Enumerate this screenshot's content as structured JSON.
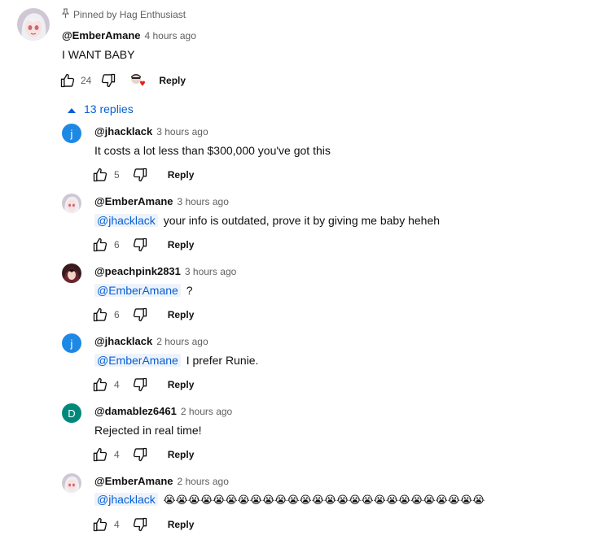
{
  "top_comment": {
    "pinned_label": "Pinned by Hag Enthusiast",
    "author": "@EmberAmane",
    "time": "4 hours ago",
    "text": "I WANT BABY",
    "likes": "24",
    "reply_label": "Reply"
  },
  "replies_toggle": {
    "label": "13 replies"
  },
  "replies": [
    {
      "author": "@jhacklack",
      "time": "3 hours ago",
      "mention": "",
      "text": "It costs a lot less than $300,000 you've got this",
      "likes": "5",
      "reply_label": "Reply",
      "avatar_letter": "j",
      "avatar_color": "#1e88e5"
    },
    {
      "author": "@EmberAmane",
      "time": "3 hours ago",
      "mention": "@jhacklack",
      "text": "your info is outdated, prove it by giving me baby heheh",
      "likes": "6",
      "reply_label": "Reply",
      "avatar_letter": "",
      "avatar_color": "#d8d2dc"
    },
    {
      "author": "@peachpink2831",
      "time": "3 hours ago",
      "mention": "@EmberAmane",
      "text": "?",
      "likes": "6",
      "reply_label": "Reply",
      "avatar_letter": "",
      "avatar_color": "#5a2a2a"
    },
    {
      "author": "@jhacklack",
      "time": "2 hours ago",
      "mention": "@EmberAmane",
      "text": "I prefer Runie.",
      "likes": "4",
      "reply_label": "Reply",
      "avatar_letter": "j",
      "avatar_color": "#1e88e5"
    },
    {
      "author": "@damablez6461",
      "time": "2 hours ago",
      "mention": "",
      "text": "Rejected in real time!",
      "likes": "4",
      "reply_label": "Reply",
      "avatar_letter": "D",
      "avatar_color": "#00897b"
    },
    {
      "author": "@EmberAmane",
      "time": "2 hours ago",
      "mention": "@jhacklack",
      "text": "😭😭😭😭😭😭😭😭😭😭😭😭😭😭😭😭😭😭😭😭😭😭😭😭😭😭",
      "likes": "4",
      "reply_label": "Reply",
      "avatar_letter": "",
      "avatar_color": "#d8d2dc"
    }
  ],
  "colors": {
    "link": "#065fd4",
    "secondary": "#606060",
    "heart": "#e62117"
  }
}
